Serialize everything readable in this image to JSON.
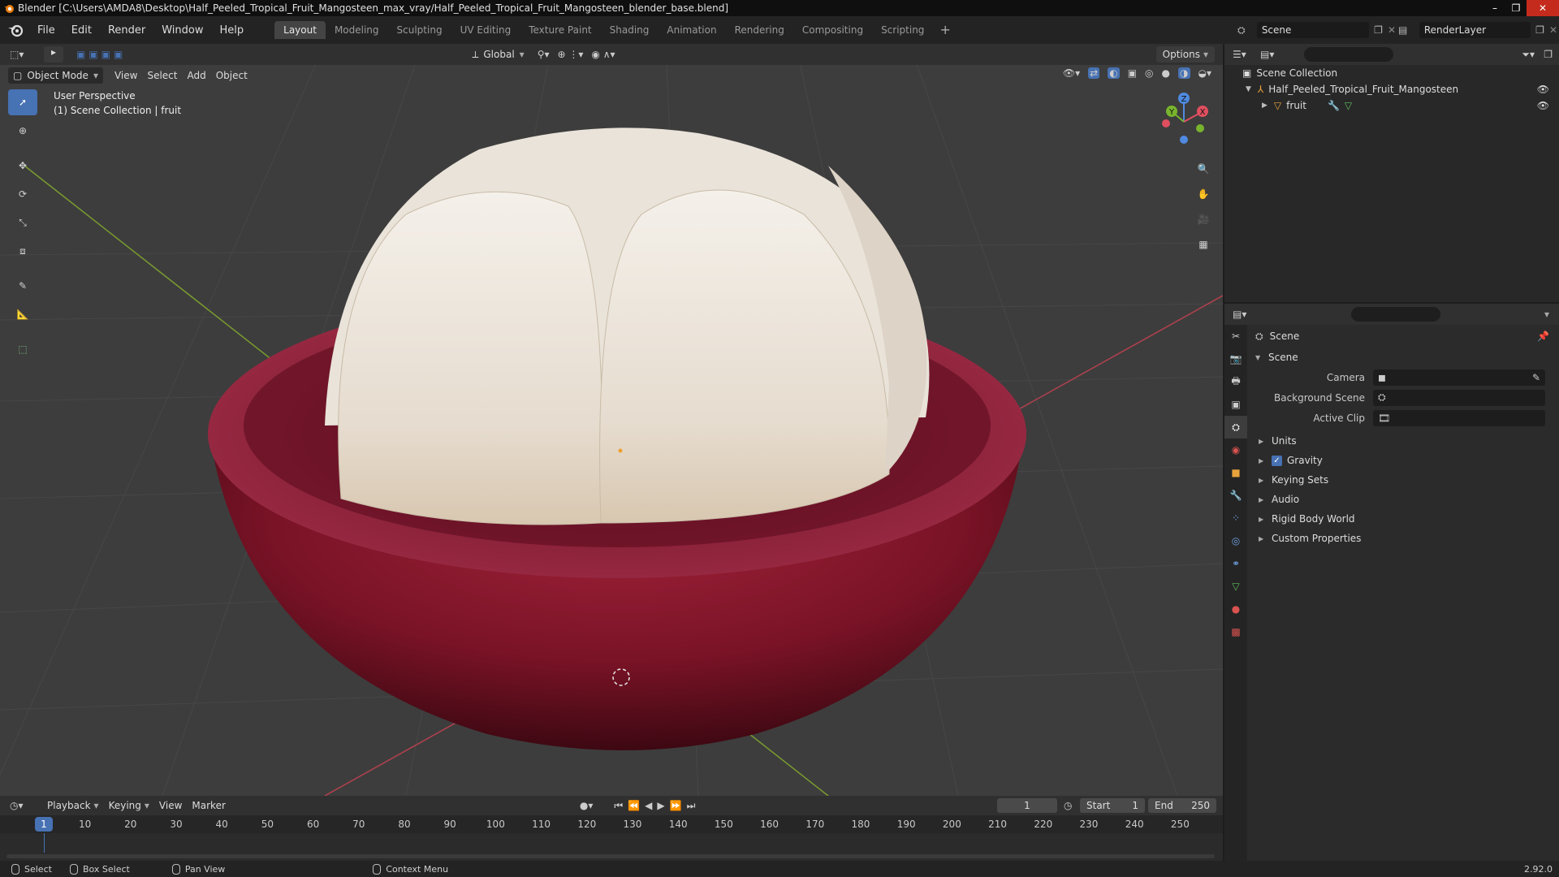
{
  "window": {
    "title": "Blender [C:\\Users\\AMDA8\\Desktop\\Half_Peeled_Tropical_Fruit_Mangosteen_max_vray/Half_Peeled_Tropical_Fruit_Mangosteen_blender_base.blend]",
    "controls": [
      "–",
      "❐",
      "✕"
    ]
  },
  "menubar": {
    "items": [
      "File",
      "Edit",
      "Render",
      "Window",
      "Help"
    ],
    "workspace_tabs": [
      "Layout",
      "Modeling",
      "Sculpting",
      "UV Editing",
      "Texture Paint",
      "Shading",
      "Animation",
      "Rendering",
      "Compositing",
      "Scripting"
    ],
    "active_tab": "Layout",
    "add_tab": "+",
    "scene": "Scene",
    "view_layer": "RenderLayer"
  },
  "viewport": {
    "transform_orientation": "Global",
    "options_label": "Options",
    "mode": "Object Mode",
    "menus": [
      "View",
      "Select",
      "Add",
      "Object"
    ],
    "perspective_text": "User Perspective",
    "collection_text": "(1) Scene Collection | fruit",
    "gizmo": {
      "x": "X",
      "y": "Y",
      "z": "Z"
    },
    "colors": {
      "background": "#3d3d3d",
      "grid": "#4a4a4a",
      "x_axis": "#b3414e",
      "y_axis": "#7a9c2f"
    }
  },
  "timeline": {
    "menus": [
      "Playback",
      "Keying",
      "View",
      "Marker"
    ],
    "current_frame": "1",
    "start_label": "Start",
    "start_value": "1",
    "end_label": "End",
    "end_value": "250",
    "ruler_marks": [
      "10",
      "20",
      "30",
      "40",
      "50",
      "60",
      "70",
      "80",
      "90",
      "100",
      "110",
      "120",
      "130",
      "140",
      "150",
      "160",
      "170",
      "180",
      "190",
      "200",
      "210",
      "220",
      "230",
      "240",
      "250"
    ],
    "playhead_label": "1"
  },
  "statusbar": {
    "select": "Select",
    "box_select": "Box Select",
    "pan_view": "Pan View",
    "context_menu": "Context Menu",
    "version": "2.92.0"
  },
  "outliner": {
    "root": "Scene Collection",
    "collection": "Half_Peeled_Tropical_Fruit_Mangosteen",
    "object": "fruit"
  },
  "properties": {
    "title": "Scene",
    "panel": "Scene",
    "camera_label": "Camera",
    "background_scene_label": "Background Scene",
    "active_clip_label": "Active Clip",
    "subpanels": [
      "Units",
      "Gravity",
      "Keying Sets",
      "Audio",
      "Rigid Body World",
      "Custom Properties"
    ],
    "gravity_checked": true
  },
  "accent": "#4772b3"
}
